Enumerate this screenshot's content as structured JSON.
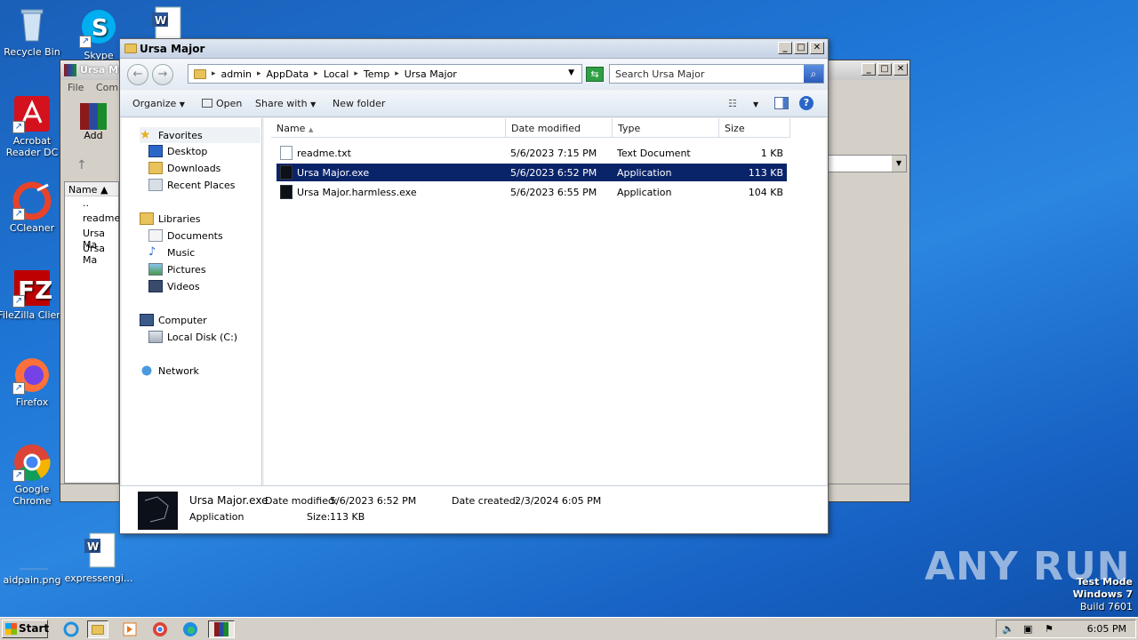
{
  "desktop": {
    "icons": [
      {
        "label": "Recycle Bin"
      },
      {
        "label": "Skype"
      },
      {
        "label": "Acrobat Reader DC"
      },
      {
        "label": "CCleaner"
      },
      {
        "label": "FileZilla Client"
      },
      {
        "label": "Firefox"
      },
      {
        "label": "Google Chrome"
      },
      {
        "label": "aidpain.png"
      },
      {
        "label": "expressengi..."
      }
    ],
    "watermark": "ANY RUN",
    "testmode": {
      "line1": "Test Mode",
      "line2": "Windows 7",
      "line3": "Build 7601"
    }
  },
  "backwindow": {
    "title": "Ursa Ma",
    "menu": [
      "File",
      "Comm"
    ],
    "add_label": "Add",
    "col_name": "Name",
    "files": [
      "..",
      "readme.",
      "Ursa Ma",
      "Ursa Ma"
    ]
  },
  "window": {
    "title": "Ursa Major",
    "breadcrumb": [
      "admin",
      "AppData",
      "Local",
      "Temp",
      "Ursa Major"
    ],
    "search_placeholder": "Search Ursa Major",
    "toolbar": {
      "organize": "Organize",
      "open": "Open",
      "share": "Share with",
      "newfolder": "New folder"
    },
    "nav": {
      "favorites": "Favorites",
      "desktop": "Desktop",
      "downloads": "Downloads",
      "recent": "Recent Places",
      "libraries": "Libraries",
      "documents": "Documents",
      "music": "Music",
      "pictures": "Pictures",
      "videos": "Videos",
      "computer": "Computer",
      "localdisk": "Local Disk (C:)",
      "network": "Network"
    },
    "columns": {
      "name": "Name",
      "date": "Date modified",
      "type": "Type",
      "size": "Size"
    },
    "files": [
      {
        "name": "readme.txt",
        "date": "5/6/2023 7:15 PM",
        "type": "Text Document",
        "size": "1 KB"
      },
      {
        "name": "Ursa Major.exe",
        "date": "5/6/2023 6:52 PM",
        "type": "Application",
        "size": "113 KB"
      },
      {
        "name": "Ursa Major.harmless.exe",
        "date": "5/6/2023 6:55 PM",
        "type": "Application",
        "size": "104 KB"
      }
    ],
    "details": {
      "filename": "Ursa Major.exe",
      "type": "Application",
      "modified_label": "Date modified:",
      "modified": "5/6/2023 6:52 PM",
      "created_label": "Date created:",
      "created": "2/3/2024 6:05 PM",
      "size_label": "Size:",
      "size": "113 KB"
    }
  },
  "taskbar": {
    "start": "Start",
    "clock": "6:05 PM"
  }
}
